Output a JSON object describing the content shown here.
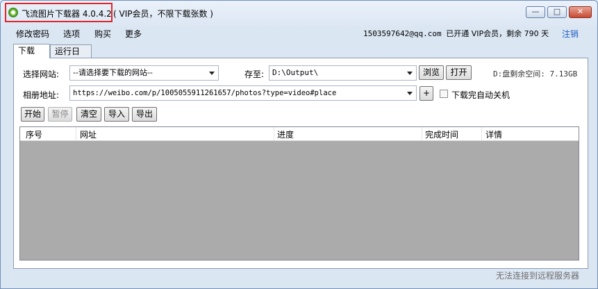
{
  "window": {
    "title": "飞流图片下载器 4.0.4.2",
    "subtitle": "( VIP会员，不限下载张数 )",
    "controls": {
      "minimize": "—",
      "maximize": "□",
      "close": "✕"
    }
  },
  "menu": {
    "items": [
      "修改密码",
      "选项",
      "购买",
      "更多"
    ],
    "account_email": "1503597642@qq.com",
    "account_status": "已开通 VIP会员，剩余 790 天",
    "logout": "注销"
  },
  "tabs": [
    {
      "label": "下载",
      "active": true
    },
    {
      "label": "运行日志",
      "active": false
    }
  ],
  "form": {
    "site_label": "选择网站:",
    "site_value": "--请选择要下载的网站--",
    "save_label": "存至:",
    "save_path": "D:\\Output\\",
    "browse_button": "浏览",
    "open_button": "打开",
    "disk_space": "D:盘剩余空间: 7.13GB",
    "album_label": "相册地址:",
    "album_url": "https://weibo.com/p/1005055911261657/photos?type=video#place",
    "add_button": "+",
    "auto_shutdown_label": "下载完自动关机",
    "auto_shutdown_checked": false
  },
  "toolbar": {
    "start": "开始",
    "pause": "暂停",
    "clear": "清空",
    "import": "导入",
    "export": "导出"
  },
  "table": {
    "columns": [
      "序号",
      "网址",
      "进度",
      "完成时间",
      "详情"
    ],
    "rows": []
  },
  "status": {
    "message": "无法连接到远程服务器"
  },
  "colors": {
    "link": "#1f5fbf",
    "highlight_box": "#e0262b",
    "grid_background": "#ababab"
  }
}
